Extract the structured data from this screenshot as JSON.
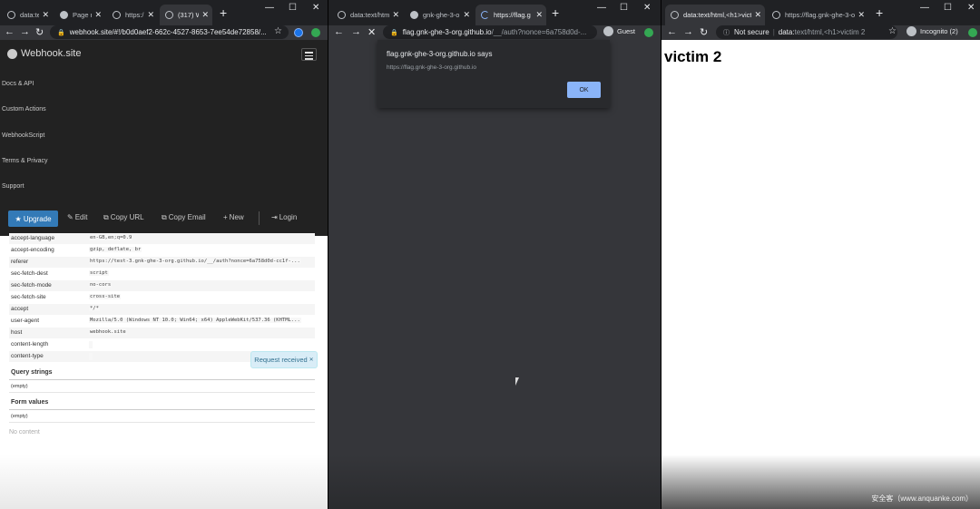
{
  "left_window": {
    "tabs": [
      {
        "label": "data:te",
        "icon": "globe-icon"
      },
      {
        "label": "Page n",
        "icon": "github-icon"
      },
      {
        "label": "https:/",
        "icon": "globe-icon"
      },
      {
        "label": "(317) W",
        "icon": "webhook-icon"
      }
    ],
    "new_tab": "+",
    "controls": {
      "minimize": "—",
      "maximize": "☐",
      "close": "✕"
    },
    "url": "webhook.site/#!/b0d0aef2-662c-4527-8653-7ee54de72858/...",
    "page": {
      "brand": "Webhook.site",
      "menu": [
        "Docs & API",
        "Custom Actions",
        "WebhookScript",
        "Terms & Privacy",
        "Support"
      ],
      "buttons": {
        "upgrade": "Upgrade",
        "edit": "Edit",
        "copy_url": "Copy URL",
        "copy_email": "Copy Email",
        "new": "New",
        "login": "Login"
      },
      "headers": [
        {
          "key": "accept-language",
          "value": "en-GB,en;q=0.9"
        },
        {
          "key": "accept-encoding",
          "value": "gzip, deflate, br"
        },
        {
          "key": "referer",
          "value": "https://test-3.gnk-ghe-3-org.github.io/__/auth?nonce=6a758d0d-cc1f-..."
        },
        {
          "key": "sec-fetch-dest",
          "value": "script"
        },
        {
          "key": "sec-fetch-mode",
          "value": "no-cors"
        },
        {
          "key": "sec-fetch-site",
          "value": "cross-site"
        },
        {
          "key": "accept",
          "value": "*/*"
        },
        {
          "key": "user-agent",
          "value": "Mozilla/5.0 (Windows NT 10.0; Win64; x64) AppleWebKit/537.36 (KHTML..."
        },
        {
          "key": "host",
          "value": "webhook.site"
        },
        {
          "key": "content-length",
          "value": ""
        },
        {
          "key": "content-type",
          "value": ""
        }
      ],
      "query_strings_title": "Query strings",
      "query_strings_value": "(empty)",
      "form_values_title": "Form values",
      "form_values_value": "(empty)",
      "no_content": "No content",
      "toast": "Request received"
    }
  },
  "middle_window": {
    "tabs": [
      {
        "label": "data:text/html",
        "icon": "globe-icon"
      },
      {
        "label": "gnk-ghe-3-o",
        "icon": "github-icon"
      },
      {
        "label": "https://flag.g",
        "icon": "loading-icon"
      }
    ],
    "new_tab": "+",
    "controls": {
      "minimize": "—",
      "maximize": "☐",
      "close": "✕"
    },
    "url_host": "flag.gnk-ghe-3-org.github.io",
    "url_path": "/__/auth?nonce=6a758d0d-...",
    "profile": "Guest",
    "dialog": {
      "title": "flag.gnk-ghe-3-org.github.io says",
      "message": "https://flag.gnk-ghe-3-org.github.io",
      "ok": "OK"
    }
  },
  "right_window": {
    "tabs": [
      {
        "label": "data:text/html,<h1>victi",
        "icon": "globe-icon"
      },
      {
        "label": "https://flag.gnk-ghe-3-o",
        "icon": "globe-icon"
      }
    ],
    "new_tab": "+",
    "controls": {
      "minimize": "—",
      "maximize": "☐",
      "close": "✕"
    },
    "not_secure": "Not secure",
    "url_scheme": "data:",
    "url_rest": "text/html,<h1>victim 2",
    "profile": "Incognito (2)",
    "heading": "victim 2"
  },
  "watermark": "安全客（www.anquanke.com）"
}
